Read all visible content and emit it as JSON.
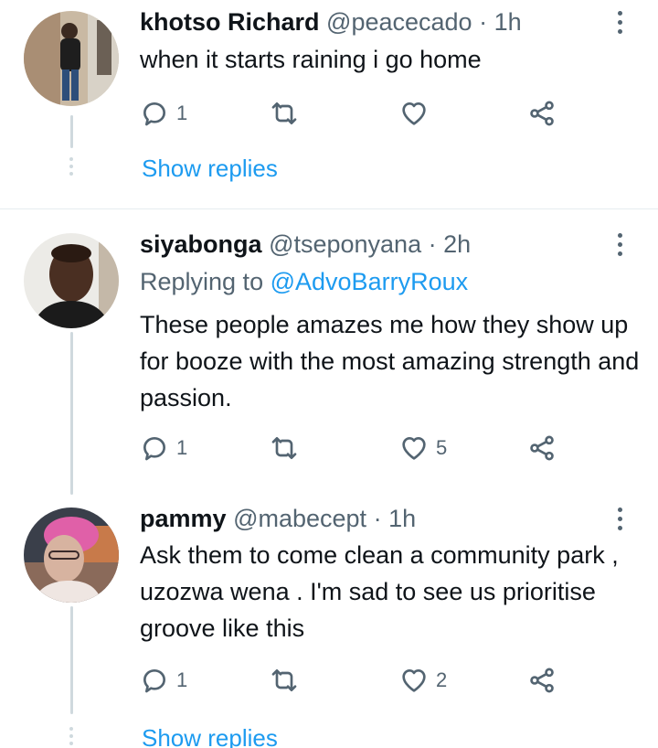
{
  "tweets": [
    {
      "name": "khotso Richard",
      "handle": "@peacecado",
      "separator": "·",
      "time": "1h",
      "replying_prefix": "",
      "replying_to": "",
      "text": "when it starts raining i go home",
      "reply_count": "1",
      "retweet_count": "",
      "like_count": "",
      "show_replies": "Show replies"
    },
    {
      "name": "siyabonga",
      "handle": "@tseponyana",
      "separator": "·",
      "time": "2h",
      "replying_prefix": "Replying to",
      "replying_to": "@AdvoBarryRoux",
      "text": "These people amazes me how they show up for booze with the most amazing strength and passion.",
      "reply_count": "1",
      "retweet_count": "",
      "like_count": "5",
      "show_replies": ""
    },
    {
      "name": "pammy",
      "handle": "@mabecept",
      "separator": "·",
      "time": "1h",
      "replying_prefix": "",
      "replying_to": "",
      "text": "Ask them to come clean a community park , uzozwa wena . I'm sad to see us prioritise groove like this",
      "reply_count": "1",
      "retweet_count": "",
      "like_count": "2",
      "show_replies": "Show replies"
    }
  ],
  "colors": {
    "link": "#1d9bf0",
    "secondary": "#536471",
    "thread_line": "#cfd9de"
  },
  "icons": [
    "reply-icon",
    "retweet-icon",
    "like-icon",
    "share-icon",
    "more-options-icon"
  ]
}
